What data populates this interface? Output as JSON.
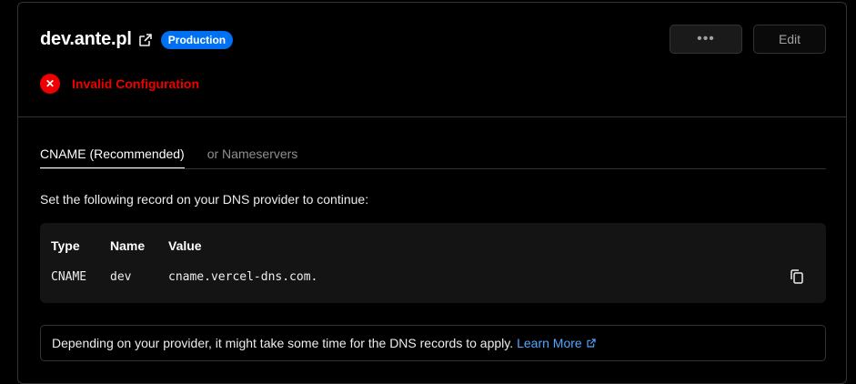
{
  "domain": {
    "name": "dev.ante.pl",
    "badge": "Production",
    "status": "Invalid Configuration",
    "status_icon": "x-circle-icon",
    "status_color": "#e00000"
  },
  "actions": {
    "more_label": "•••",
    "edit_label": "Edit"
  },
  "tabs": [
    {
      "label": "CNAME (Recommended)",
      "active": true
    },
    {
      "label": "or Nameservers",
      "active": false
    }
  ],
  "instructions": "Set the following record on your DNS provider to continue:",
  "dns_table": {
    "headers": [
      "Type",
      "Name",
      "Value"
    ],
    "rows": [
      {
        "type": "CNAME",
        "name": "dev",
        "value": "cname.vercel-dns.com."
      }
    ]
  },
  "note": {
    "text": "Depending on your provider, it might take some time for the DNS records to apply.",
    "link": "Learn More"
  },
  "colors": {
    "accent": "#0070f3",
    "link": "#52a8ff",
    "error": "#e00000",
    "background": "#000000"
  }
}
